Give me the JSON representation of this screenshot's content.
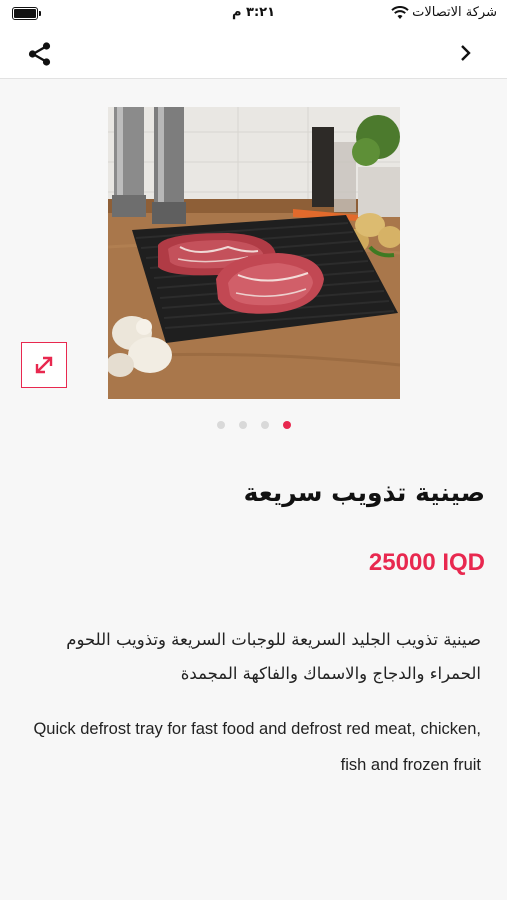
{
  "status_bar": {
    "carrier": "شركة الاتصالات",
    "time": "٣:٢١ م",
    "battery_level": 1.0
  },
  "nav": {
    "share_icon": "share-icon",
    "back_icon": "chevron-right-icon"
  },
  "gallery": {
    "image_description_icon": "product-photo",
    "expand_icon": "expand-arrows-icon",
    "page_count": 4,
    "active_page": 4
  },
  "product": {
    "title": "صينية تذويب سريعة",
    "price": "25000 IQD",
    "description_ar": "صينية تذويب الجليد السريعة للوجبات السريعة وتذويب اللحوم الحمراء والدجاج والاسماك والفاكهة المجمدة",
    "description_en": "Quick defrost tray for fast food and defrost red meat, chicken, fish and frozen fruit"
  },
  "colors": {
    "accent": "#e8284f",
    "background": "#f7f7f7"
  }
}
